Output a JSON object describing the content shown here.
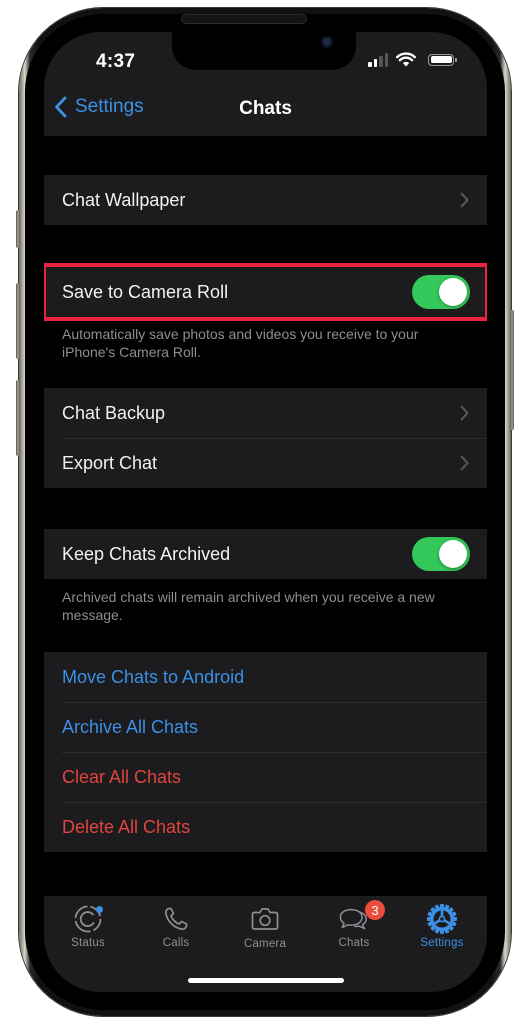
{
  "status_bar": {
    "time": "4:37",
    "signal_bars_active": 2,
    "signal_bars_total": 4,
    "battery_level": 1.0
  },
  "nav": {
    "back_label": "Settings",
    "title": "Chats"
  },
  "sections": {
    "wallpaper": {
      "label": "Chat Wallpaper"
    },
    "camera_roll": {
      "label": "Save to Camera Roll",
      "enabled": true,
      "footnote": "Automatically save photos and videos you receive to your iPhone's Camera Roll."
    },
    "backup": [
      {
        "label": "Chat Backup"
      },
      {
        "label": "Export Chat"
      }
    ],
    "archived": {
      "label": "Keep Chats Archived",
      "enabled": true,
      "footnote": "Archived chats will remain archived when you receive a new message."
    },
    "actions": [
      {
        "label": "Move Chats to Android",
        "tone": "blue"
      },
      {
        "label": "Archive All Chats",
        "tone": "blue"
      },
      {
        "label": "Clear All Chats",
        "tone": "red"
      },
      {
        "label": "Delete All Chats",
        "tone": "red"
      }
    ]
  },
  "tabbar": {
    "tabs": [
      {
        "label": "Status",
        "icon": "status-icon",
        "has_dot": true
      },
      {
        "label": "Calls",
        "icon": "phone-icon"
      },
      {
        "label": "Camera",
        "icon": "camera-icon"
      },
      {
        "label": "Chats",
        "icon": "chat-bubbles-icon",
        "badge": "3"
      },
      {
        "label": "Settings",
        "icon": "gear-icon",
        "active": true
      }
    ]
  },
  "colors": {
    "accent_blue": "#3d8fe4",
    "destructive_red": "#e0443e",
    "toggle_on": "#34c759",
    "highlight_border": "#e8253f",
    "badge_red": "#eb4d3d"
  }
}
